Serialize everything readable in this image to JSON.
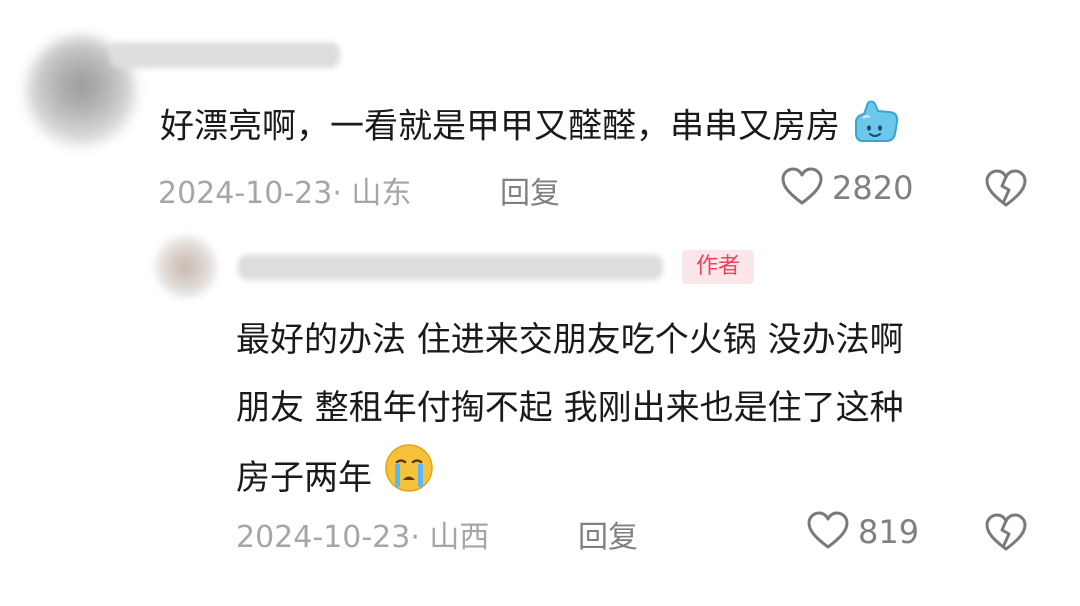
{
  "comment": {
    "text": "好漂亮啊，一看就是甲甲又醛醛，串串又房房",
    "emoji_icon": "thumbs-up-blob-icon",
    "date_location": "2024-10-23· 山东",
    "reply_label": "回复",
    "like_count": "2820"
  },
  "reply": {
    "badge": "作者",
    "line1": "最好的办法 住进来交朋友吃个火锅 没办法啊",
    "line2": "朋友 整租年付掏不起 我刚出来也是住了这种",
    "line3": "房子两年",
    "emoji_icon": "crying-face-icon",
    "date_location": "2024-10-23· 山西",
    "reply_label": "回复",
    "like_count": "819"
  },
  "colors": {
    "badge_bg": "#fbe6ea",
    "badge_text": "#f04060",
    "meta_text": "#a6a6a6",
    "action_text": "#808080"
  }
}
